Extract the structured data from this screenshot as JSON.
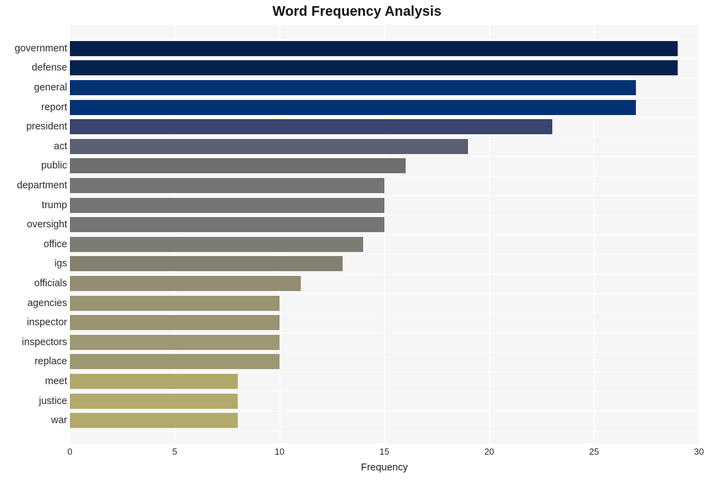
{
  "chart_data": {
    "type": "bar",
    "orientation": "horizontal",
    "title": "Word Frequency Analysis",
    "xlabel": "Frequency",
    "ylabel": "",
    "xlim": [
      0,
      30
    ],
    "xticks": [
      0,
      5,
      10,
      15,
      20,
      25,
      30
    ],
    "xtick_labels": [
      "0",
      "5",
      "10",
      "15",
      "20",
      "25",
      "30"
    ],
    "grid": true,
    "grid_color": "#ffffff",
    "plot_background": "#f6f6f6",
    "figure_background": "#ffffff",
    "legend": null,
    "categories": [
      "government",
      "defense",
      "general",
      "report",
      "president",
      "act",
      "public",
      "department",
      "trump",
      "oversight",
      "office",
      "igs",
      "officials",
      "agencies",
      "inspector",
      "inspectors",
      "replace",
      "meet",
      "justice",
      "war"
    ],
    "values": [
      29,
      29,
      27,
      27,
      23,
      19,
      16,
      15,
      15,
      15,
      14,
      13,
      11,
      10,
      10,
      10,
      10,
      8,
      8,
      8
    ],
    "bar_colors": [
      "#04214b",
      "#04234d",
      "#023272",
      "#023272",
      "#3b456e",
      "#5a6070",
      "#6f6f70",
      "#757573",
      "#757573",
      "#757573",
      "#7c7b74",
      "#84806f",
      "#928c72",
      "#9a9473",
      "#9a9473",
      "#9d9774",
      "#9d9774",
      "#b0a76c",
      "#b2a96b",
      "#b2a96b"
    ],
    "bars": [
      {
        "label": "government",
        "value": 29,
        "color": "#04214b"
      },
      {
        "label": "defense",
        "value": 29,
        "color": "#04234d"
      },
      {
        "label": "general",
        "value": 27,
        "color": "#023272"
      },
      {
        "label": "report",
        "value": 27,
        "color": "#023272"
      },
      {
        "label": "president",
        "value": 23,
        "color": "#3b456e"
      },
      {
        "label": "act",
        "value": 19,
        "color": "#5a6070"
      },
      {
        "label": "public",
        "value": 16,
        "color": "#6f6f70"
      },
      {
        "label": "department",
        "value": 15,
        "color": "#757573"
      },
      {
        "label": "trump",
        "value": 15,
        "color": "#757573"
      },
      {
        "label": "oversight",
        "value": 15,
        "color": "#757573"
      },
      {
        "label": "office",
        "value": 14,
        "color": "#7c7b74"
      },
      {
        "label": "igs",
        "value": 13,
        "color": "#84806f"
      },
      {
        "label": "officials",
        "value": 11,
        "color": "#928c72"
      },
      {
        "label": "agencies",
        "value": 10,
        "color": "#9a9473"
      },
      {
        "label": "inspector",
        "value": 10,
        "color": "#9a9473"
      },
      {
        "label": "inspectors",
        "value": 10,
        "color": "#9d9774"
      },
      {
        "label": "replace",
        "value": 10,
        "color": "#9d9774"
      },
      {
        "label": "meet",
        "value": 8,
        "color": "#b0a76c"
      },
      {
        "label": "justice",
        "value": 8,
        "color": "#b2a96b"
      },
      {
        "label": "war",
        "value": 8,
        "color": "#b2a96b"
      }
    ]
  }
}
